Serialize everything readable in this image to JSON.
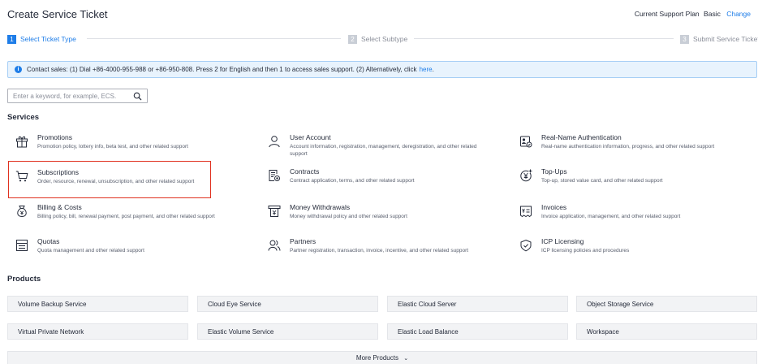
{
  "header": {
    "title": "Create Service Ticket",
    "plan_label": "Current Support Plan",
    "plan_level": "Basic",
    "change_label": "Change"
  },
  "steps": [
    {
      "number": "1",
      "label": "Select Ticket Type",
      "active": true
    },
    {
      "number": "2",
      "label": "Select Subtype",
      "active": false
    },
    {
      "number": "3",
      "label": "Submit Service Ticket",
      "active": false
    }
  ],
  "notice": {
    "text": "Contact sales: (1) Dial +86-4000-955-988 or +86-950-808. Press 2 for English and then 1 to access sales support. (2) Alternatively, click",
    "link": "here",
    "tail": "."
  },
  "search": {
    "placeholder": "Enter a keyword, for example, ECS.",
    "value": ""
  },
  "services_title": "Services",
  "services": [
    {
      "icon": "gift-icon",
      "title": "Promotions",
      "desc": "Promotion policy, lottery info, beta test, and other related support"
    },
    {
      "icon": "user-icon",
      "title": "User Account",
      "desc": "Account information, registration, management, deregistration, and other related support"
    },
    {
      "icon": "id-card-icon",
      "title": "Real-Name Authentication",
      "desc": "Real-name authentication information, progress, and other related support"
    },
    {
      "icon": "cart-icon",
      "title": "Subscriptions",
      "desc": "Order, resource, renewal, unsubscription, and other related support"
    },
    {
      "icon": "contract-icon",
      "title": "Contracts",
      "desc": "Contract application, terms, and other related support"
    },
    {
      "icon": "yuan-plus-icon",
      "title": "Top-Ups",
      "desc": "Top-up, stored value card, and other related support"
    },
    {
      "icon": "money-bag-icon",
      "title": "Billing & Costs",
      "desc": "Billing policy, bill, renewal payment, post payment, and other related support"
    },
    {
      "icon": "withdraw-icon",
      "title": "Money Withdrawals",
      "desc": "Money withdrawal policy and other related support"
    },
    {
      "icon": "invoice-icon",
      "title": "Invoices",
      "desc": "Invoice application, management, and other related support"
    },
    {
      "icon": "quota-icon",
      "title": "Quotas",
      "desc": "Quota management and other related support"
    },
    {
      "icon": "partner-icon",
      "title": "Partners",
      "desc": "Partner registration, transaction, invoice, incentive, and other related support"
    },
    {
      "icon": "shield-check-icon",
      "title": "ICP Licensing",
      "desc": "ICP licensing policies and procedures"
    }
  ],
  "products_title": "Products",
  "products": [
    "Volume Backup Service",
    "Cloud Eye Service",
    "Elastic Cloud Server",
    "Object Storage Service",
    "Virtual Private Network",
    "Elastic Volume Service",
    "Elastic Load Balance",
    "Workspace"
  ],
  "more_products": "More Products",
  "colors": {
    "accent": "#1e7de8",
    "highlight": "#e0311f"
  }
}
